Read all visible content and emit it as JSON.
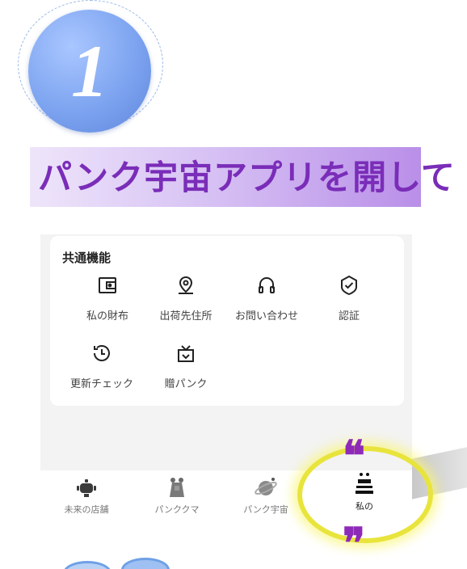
{
  "step": {
    "number": "1"
  },
  "banner": {
    "title": "パンク宇宙アプリを開して"
  },
  "card": {
    "title": "共通機能",
    "features": [
      {
        "label": "私の財布",
        "icon": "wallet-icon"
      },
      {
        "label": "出荷先住所",
        "icon": "location-pin-icon"
      },
      {
        "label": "お問い合わせ",
        "icon": "headset-icon"
      },
      {
        "label": "認証",
        "icon": "shield-check-icon"
      },
      {
        "label": "更新チェック",
        "icon": "history-clock-icon"
      },
      {
        "label": "贈パンク",
        "icon": "gift-icon"
      }
    ]
  },
  "tabs": [
    {
      "label": "未来の店舗",
      "icon": "robot-icon",
      "active": false
    },
    {
      "label": "パンククマ",
      "icon": "bear-icon",
      "active": false
    },
    {
      "label": "パンク宇宙",
      "icon": "planet-icon",
      "active": false
    },
    {
      "label": "私の",
      "icon": "person-icon",
      "active": true
    }
  ],
  "colors": {
    "step_blue": "#7da4f0",
    "banner_text": "#7a2db8",
    "highlight": "#e8e43c",
    "quote": "#8e2ab8"
  }
}
